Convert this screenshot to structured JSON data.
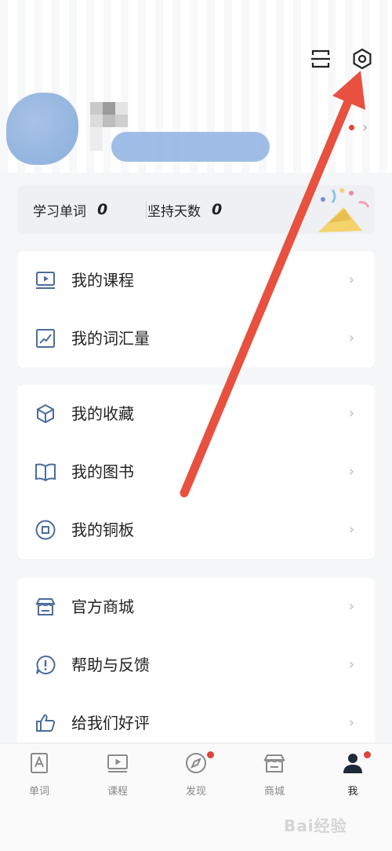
{
  "stats": {
    "words_label": "学习单词",
    "words_value": "0",
    "days_label": "坚持天数",
    "days_value": "0"
  },
  "menu_groups": [
    {
      "items": [
        {
          "label": "我的课程",
          "icon": "video-lesson-icon"
        },
        {
          "label": "我的词汇量",
          "icon": "trend-chart-icon"
        }
      ]
    },
    {
      "items": [
        {
          "label": "我的收藏",
          "icon": "cube-icon"
        },
        {
          "label": "我的图书",
          "icon": "open-book-icon"
        },
        {
          "label": "我的铜板",
          "icon": "coin-icon"
        }
      ]
    },
    {
      "items": [
        {
          "label": "官方商城",
          "icon": "store-icon"
        },
        {
          "label": "帮助与反馈",
          "icon": "feedback-icon"
        },
        {
          "label": "给我们好评",
          "icon": "thumbs-up-icon"
        }
      ]
    }
  ],
  "tabbar": {
    "tabs": [
      {
        "label": "单词",
        "icon": "word-card-icon"
      },
      {
        "label": "课程",
        "icon": "video-lesson-icon"
      },
      {
        "label": "发现",
        "icon": "compass-icon",
        "badge": true
      },
      {
        "label": "商城",
        "icon": "store-icon"
      },
      {
        "label": "我",
        "icon": "person-icon",
        "badge": true,
        "active": true
      }
    ]
  },
  "watermark": "Bai经验",
  "colors": {
    "accent_red": "#e0433a",
    "icon_blue": "#4a6d9c",
    "annotation_arrow": "#e8503f"
  }
}
